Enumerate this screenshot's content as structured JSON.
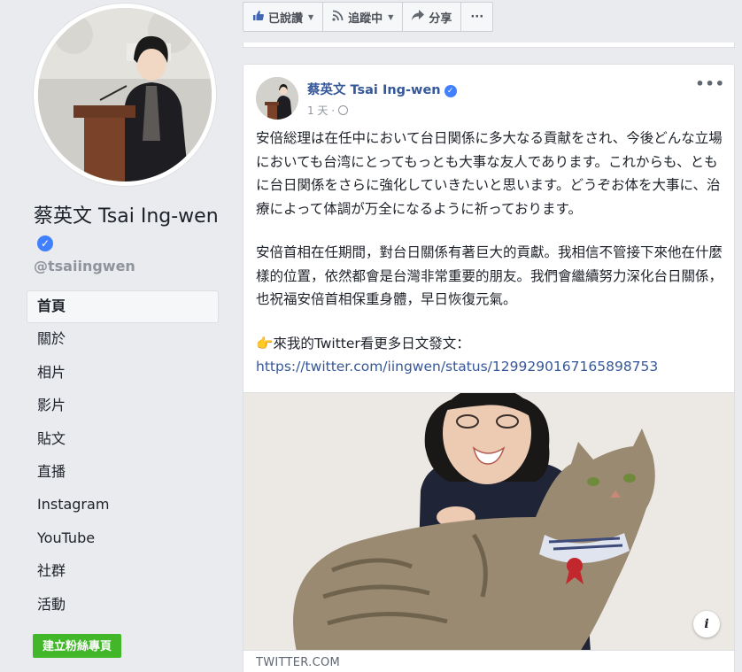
{
  "page": {
    "name": "蔡英文 Tsai Ing-wen",
    "handle": "@tsaiingwen",
    "nav": [
      {
        "label": "首頁"
      },
      {
        "label": "關於"
      },
      {
        "label": "相片"
      },
      {
        "label": "影片"
      },
      {
        "label": "貼文"
      },
      {
        "label": "直播"
      },
      {
        "label": "Instagram"
      },
      {
        "label": "YouTube"
      },
      {
        "label": "社群"
      },
      {
        "label": "活動"
      }
    ],
    "create_page_label": "建立粉絲專頁"
  },
  "actionbar": {
    "liked_label": "已說讚",
    "following_label": "追蹤中",
    "share_label": "分享",
    "more_label": "···"
  },
  "post": {
    "author": "蔡英文 Tsai Ing-wen",
    "time": "1 天",
    "more_label": "•••",
    "para_jp": "安倍総理は在任中において台日関係に多大なる貢献をされ、今後どんな立場においても台湾にとってもっとも大事な友人であります。これからも、ともに台日関係をさらに強化していきたいと思います。どうぞお体を大事に、治療によって体調が万全になるように祈っております。",
    "para_zh": "安倍首相在任期間，對台日關係有著巨大的貢獻。我相信不管接下來他在什麼樣的位置，依然都會是台灣非常重要的朋友。我們會繼續努力深化台日關係，也祝福安倍首相保重身體，早日恢復元氣。",
    "twitter_line": "來我的Twitter看更多日文發文：",
    "twitter_url": "https://twitter.com/iingwen/status/1299290167165898753",
    "link_domain": "TWITTER.COM",
    "info_label": "i"
  },
  "colors": {
    "link": "#365899",
    "verified": "#4080ff",
    "create_button": "#42b72a",
    "background": "#e9ebee"
  },
  "icons": {
    "verified": "verified-badge-icon",
    "like": "thumbs-up-icon",
    "follow": "rss-icon",
    "share": "share-arrow-icon",
    "globe": "globe-icon",
    "hand": "pointing-hand-icon",
    "info": "info-icon"
  }
}
